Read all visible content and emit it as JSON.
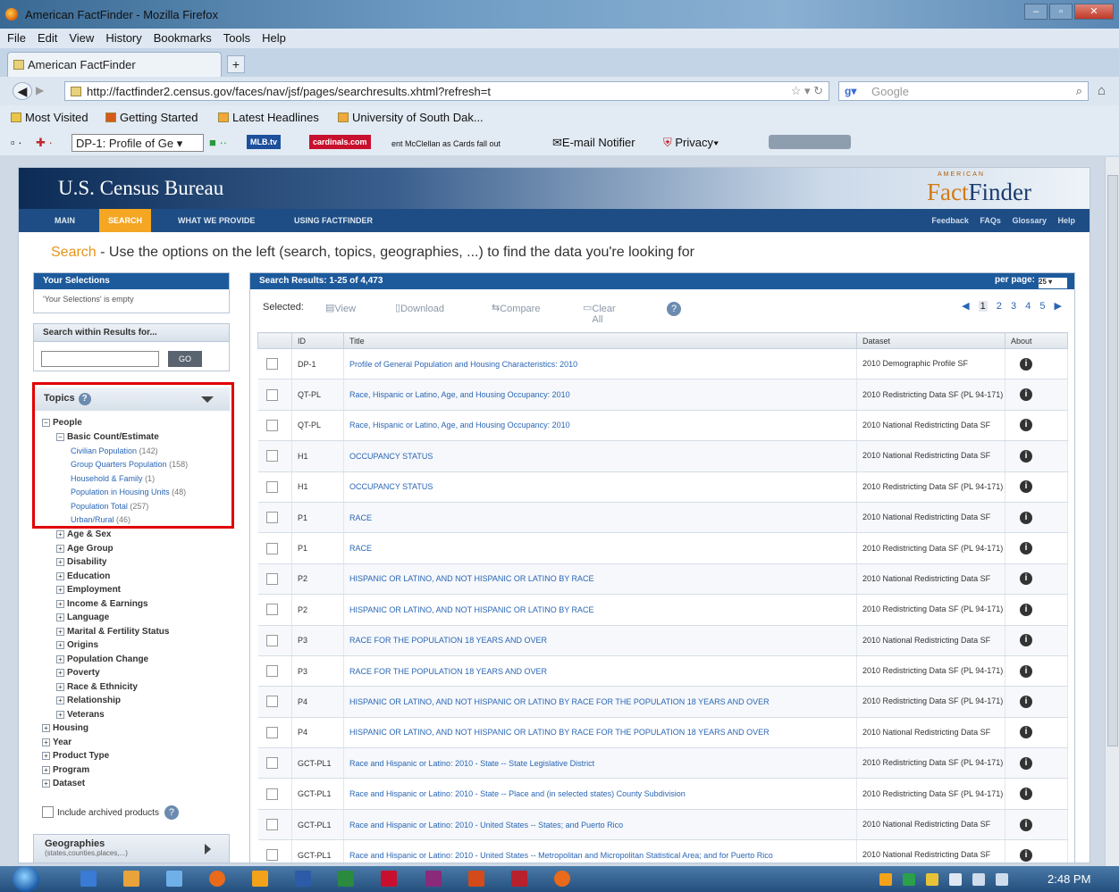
{
  "window": {
    "title": "American FactFinder - Mozilla Firefox"
  },
  "menu": [
    "File",
    "Edit",
    "View",
    "History",
    "Bookmarks",
    "Tools",
    "Help"
  ],
  "tab": {
    "label": "American FactFinder",
    "new_tab": "+"
  },
  "nav": {
    "url": "http://factfinder2.census.gov/faces/nav/jsf/pages/searchresults.xhtml?refresh=t",
    "search_placeholder": "Google"
  },
  "bookmarks": [
    "Most Visited",
    "Getting Started",
    "Latest Headlines",
    "University of South Dak..."
  ],
  "toolbar2": {
    "dropdown": "DP-1: Profile of Ge",
    "mlb": "MLB.tv",
    "cardinals": "cardinals.com",
    "ticker": "ent McClellan as Cards fall out",
    "email": "E-mail Notifier",
    "privacy": "Privacy"
  },
  "page": {
    "census_logo": "U.S. Census Bureau",
    "ff_small": "AMERICAN",
    "ff_fact": "Fact",
    "ff_finder": "Finder",
    "nav": [
      "MAIN",
      "SEARCH",
      "WHAT WE PROVIDE",
      "USING FACTFINDER"
    ],
    "nav_right": [
      "Feedback",
      "FAQs",
      "Glossary",
      "Help"
    ],
    "heading_search": "Search",
    "heading_text": " - Use the options on the left (search, topics, geographies, ...) to find the data you're looking for",
    "your_selections": "Your Selections",
    "selections_empty": "'Your Selections' is empty",
    "search_within": "Search within Results for...",
    "go": "GO",
    "topics": "Topics",
    "help_glyph": "?",
    "tree": {
      "people": "People",
      "basic": "Basic Count/Estimate",
      "leaves": [
        {
          "label": "Civilian Population",
          "count": "(142)"
        },
        {
          "label": "Group Quarters Population",
          "count": "(158)"
        },
        {
          "label": "Household & Family",
          "count": "(1)"
        },
        {
          "label": "Population in Housing Units",
          "count": "(48)"
        },
        {
          "label": "Population Total",
          "count": "(257)"
        },
        {
          "label": "Urban/Rural",
          "count": "(46)"
        }
      ],
      "people_children": [
        "Age & Sex",
        "Age Group",
        "Disability",
        "Education",
        "Employment",
        "Income & Earnings",
        "Language",
        "Marital & Fertility Status",
        "Origins",
        "Population Change",
        "Poverty",
        "Race & Ethnicity",
        "Relationship",
        "Veterans"
      ],
      "top_level": [
        "Housing",
        "Year",
        "Product Type",
        "Program",
        "Dataset"
      ]
    },
    "archived": "Include archived products",
    "geographies": "Geographies",
    "geographies_sub": "(states,counties,places,...)"
  },
  "results": {
    "header": "Search Results: 1-25 of 4,473",
    "per_page_label": "per page:",
    "per_page": "25",
    "selected": "Selected:",
    "actions": [
      "View",
      "Download",
      "Compare",
      "Clear All"
    ],
    "pages": [
      "1",
      "2",
      "3",
      "4",
      "5"
    ],
    "columns": [
      "ID",
      "Title",
      "Dataset",
      "About"
    ],
    "rows": [
      {
        "id": "DP-1",
        "title": "Profile of General Population and Housing Characteristics: 2010",
        "dataset": "2010 Demographic Profile SF"
      },
      {
        "id": "QT-PL",
        "title": "Race, Hispanic or Latino, Age, and Housing Occupancy: 2010",
        "dataset": "2010 Redistricting Data SF (PL 94-171)"
      },
      {
        "id": "QT-PL",
        "title": "Race, Hispanic or Latino, Age, and Housing Occupancy: 2010",
        "dataset": "2010 National Redistricting Data SF"
      },
      {
        "id": "H1",
        "title": "OCCUPANCY STATUS",
        "dataset": "2010 National Redistricting Data SF"
      },
      {
        "id": "H1",
        "title": "OCCUPANCY STATUS",
        "dataset": "2010 Redistricting Data SF (PL 94-171)"
      },
      {
        "id": "P1",
        "title": "RACE",
        "dataset": "2010 National Redistricting Data SF"
      },
      {
        "id": "P1",
        "title": "RACE",
        "dataset": "2010 Redistricting Data SF (PL 94-171)"
      },
      {
        "id": "P2",
        "title": "HISPANIC OR LATINO, AND NOT HISPANIC OR LATINO BY RACE",
        "dataset": "2010 National Redistricting Data SF"
      },
      {
        "id": "P2",
        "title": "HISPANIC OR LATINO, AND NOT HISPANIC OR LATINO BY RACE",
        "dataset": "2010 Redistricting Data SF (PL 94-171)"
      },
      {
        "id": "P3",
        "title": "RACE FOR THE POPULATION 18 YEARS AND OVER",
        "dataset": "2010 National Redistricting Data SF"
      },
      {
        "id": "P3",
        "title": "RACE FOR THE POPULATION 18 YEARS AND OVER",
        "dataset": "2010 Redistricting Data SF (PL 94-171)"
      },
      {
        "id": "P4",
        "title": "HISPANIC OR LATINO, AND NOT HISPANIC OR LATINO BY RACE FOR THE POPULATION 18 YEARS AND OVER",
        "dataset": "2010 Redistricting Data SF (PL 94-171)"
      },
      {
        "id": "P4",
        "title": "HISPANIC OR LATINO, AND NOT HISPANIC OR LATINO BY RACE FOR THE POPULATION 18 YEARS AND OVER",
        "dataset": "2010 National Redistricting Data SF"
      },
      {
        "id": "GCT-PL1",
        "title": "Race and Hispanic or Latino: 2010 - State -- State Legislative District",
        "dataset": "2010 Redistricting Data SF (PL 94-171)"
      },
      {
        "id": "GCT-PL1",
        "title": "Race and Hispanic or Latino: 2010 - State -- Place and (in selected states) County Subdivision",
        "dataset": "2010 Redistricting Data SF (PL 94-171)"
      },
      {
        "id": "GCT-PL1",
        "title": "Race and Hispanic or Latino: 2010 - United States -- States; and Puerto Rico",
        "dataset": "2010 National Redistricting Data SF"
      },
      {
        "id": "GCT-PL1",
        "title": "Race and Hispanic or Latino: 2010 - United States -- Metropolitan and Micropolitan Statistical Area; and for Puerto Rico",
        "dataset": "2010 National Redistricting Data SF"
      }
    ]
  },
  "taskbar": {
    "clock": "2:48 PM"
  }
}
